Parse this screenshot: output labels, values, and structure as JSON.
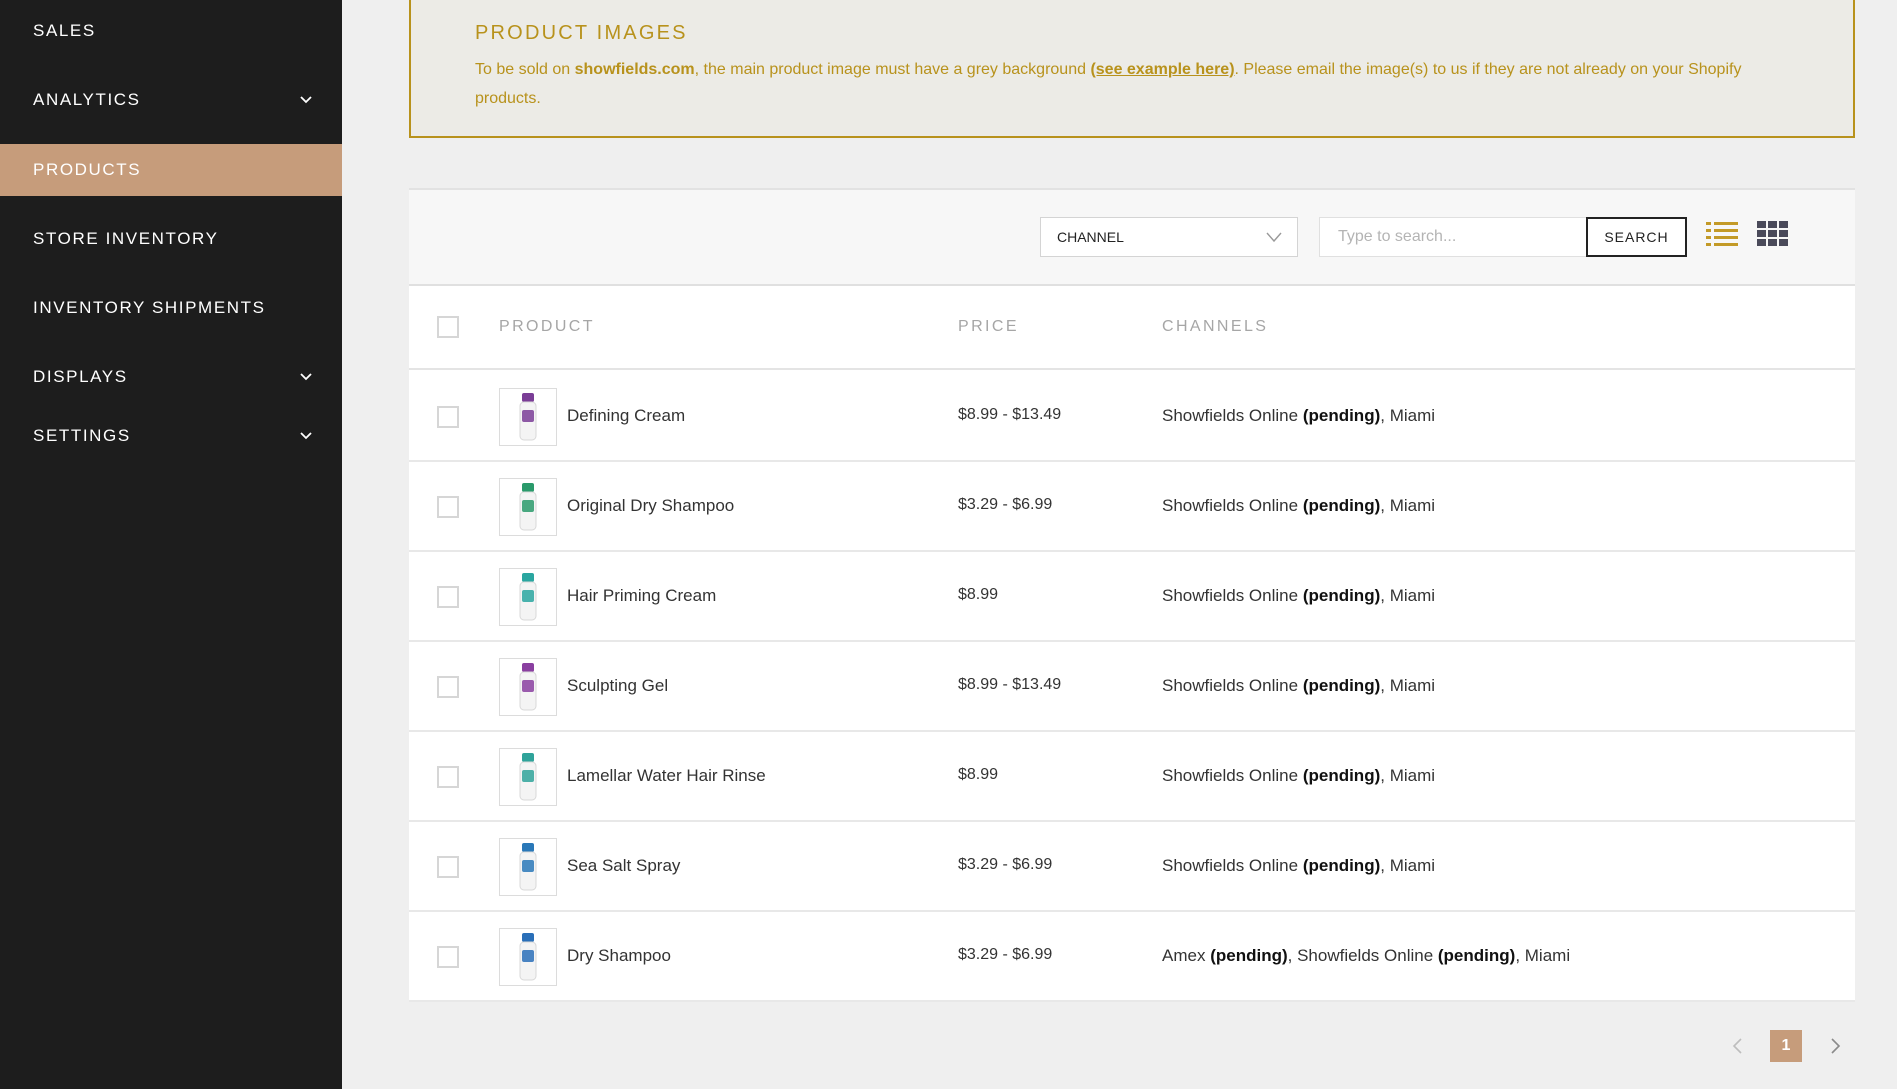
{
  "sidebar": {
    "items": [
      {
        "label": "SALES",
        "has_chevron": false,
        "active": false
      },
      {
        "label": "ANALYTICS",
        "has_chevron": true,
        "active": false
      },
      {
        "label": "PRODUCTS",
        "has_chevron": false,
        "active": true
      },
      {
        "label": "STORE INVENTORY",
        "has_chevron": false,
        "active": false
      },
      {
        "label": "INVENTORY SHIPMENTS",
        "has_chevron": false,
        "active": false
      },
      {
        "label": "DISPLAYS",
        "has_chevron": true,
        "active": false
      },
      {
        "label": "SETTINGS",
        "has_chevron": true,
        "active": false
      }
    ],
    "active_color": "#c69c7b",
    "background": "#1d1d1d"
  },
  "banner": {
    "title": "PRODUCT IMAGES",
    "text_before": "To be sold on ",
    "site": "showfields.com",
    "text_middle": ", the main product image must have a grey background ",
    "link": "(see example here)",
    "text_after": ". Please email the image(s) to us if they are not already on your Shopify products.",
    "accent": "#b8921c"
  },
  "toolbar": {
    "channel_select": "CHANNEL",
    "search_placeholder": "Type to search...",
    "search_button": "SEARCH",
    "list_view_icon": "list-view-icon",
    "grid_view_icon": "grid-view-icon"
  },
  "table": {
    "headers": {
      "product": "PRODUCT",
      "price": "PRICE",
      "channels": "CHANNELS"
    },
    "rows": [
      {
        "name": "Defining Cream",
        "price": "$8.99 - $13.49",
        "thumb_color": "#7a3d96",
        "channels": [
          {
            "name": "Showfields Online",
            "status": "(pending)"
          },
          {
            "name": "Miami",
            "status": ""
          }
        ]
      },
      {
        "name": "Original Dry Shampoo",
        "price": "$3.29 - $6.99",
        "thumb_color": "#2a9a6b",
        "channels": [
          {
            "name": "Showfields Online",
            "status": "(pending)"
          },
          {
            "name": "Miami",
            "status": ""
          }
        ]
      },
      {
        "name": "Hair Priming Cream",
        "price": "$8.99",
        "thumb_color": "#2aa6a0",
        "channels": [
          {
            "name": "Showfields Online",
            "status": "(pending)"
          },
          {
            "name": "Miami",
            "status": ""
          }
        ]
      },
      {
        "name": "Sculpting Gel",
        "price": "$8.99 - $13.49",
        "thumb_color": "#8a3fa0",
        "channels": [
          {
            "name": "Showfields Online",
            "status": "(pending)"
          },
          {
            "name": "Miami",
            "status": ""
          }
        ]
      },
      {
        "name": "Lamellar Water Hair Rinse",
        "price": "$8.99",
        "thumb_color": "#2fa39a",
        "channels": [
          {
            "name": "Showfields Online",
            "status": "(pending)"
          },
          {
            "name": "Miami",
            "status": ""
          }
        ]
      },
      {
        "name": "Sea Salt Spray",
        "price": "$3.29 - $6.99",
        "thumb_color": "#2a78b8",
        "channels": [
          {
            "name": "Showfields Online",
            "status": "(pending)"
          },
          {
            "name": "Miami",
            "status": ""
          }
        ]
      },
      {
        "name": "Dry Shampoo",
        "price": "$3.29 - $6.99",
        "thumb_color": "#2a6fb8",
        "channels": [
          {
            "name": "Amex",
            "status": "(pending)"
          },
          {
            "name": "Showfields Online",
            "status": "(pending)"
          },
          {
            "name": "Miami",
            "status": ""
          }
        ]
      }
    ]
  },
  "pagination": {
    "prev_icon": "chevron-left-icon",
    "current_page": "1",
    "next_icon": "chevron-right-icon"
  }
}
